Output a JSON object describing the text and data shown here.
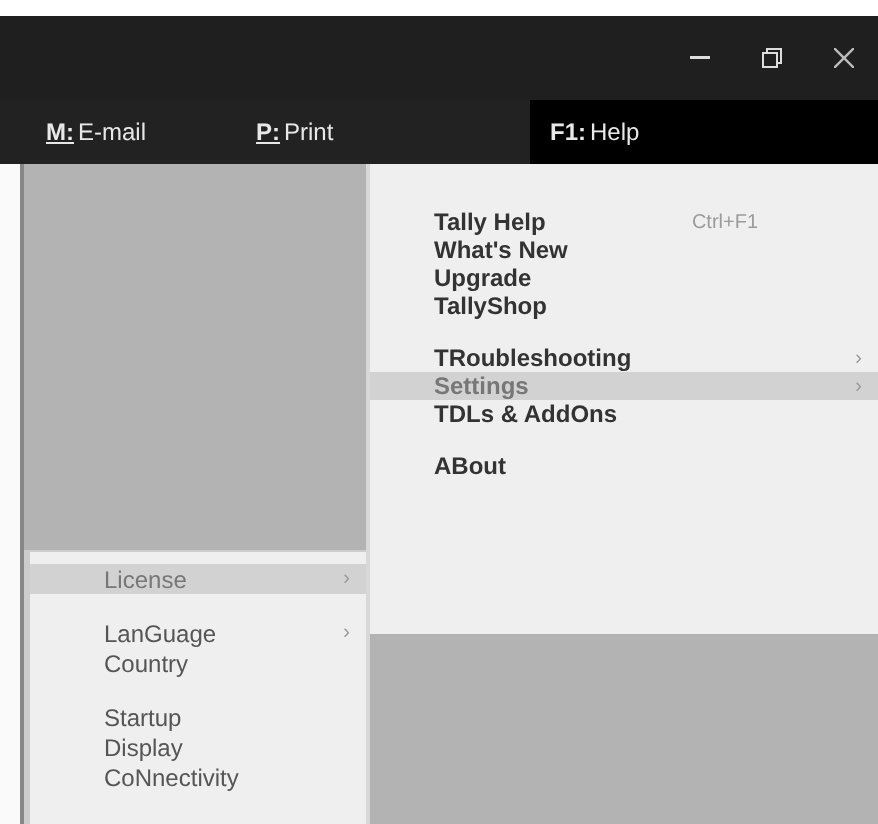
{
  "window": {
    "controls": [
      {
        "kind": "minimize"
      },
      {
        "kind": "restore"
      },
      {
        "kind": "close"
      }
    ]
  },
  "menu_bar": [
    {
      "key": "M:",
      "label": "E-mail",
      "underlined": true,
      "selected": false
    },
    {
      "key": "P:",
      "label": "Print",
      "underlined": true,
      "selected": false
    },
    {
      "key": "F1:",
      "label": "Help",
      "underlined": false,
      "selected": true
    }
  ],
  "help_menu": {
    "groups": [
      [
        {
          "label": "Tally Help",
          "shortcut": "Ctrl+F1",
          "selected": false
        },
        {
          "label": "What's **N**ew",
          "selected": false
        },
        {
          "label": "Upgrade",
          "selected": false
        },
        {
          "label": "TallyShop",
          "selected": false
        }
      ],
      [
        {
          "label": "TRoubleshooting",
          "arrow": "›",
          "selected": false
        },
        {
          "label": "Settings",
          "arrow": "›",
          "selected": true
        },
        {
          "label": "TDLs & AddOns",
          "selected": false
        }
      ],
      [
        {
          "label": "ABout",
          "selected": false
        }
      ]
    ]
  },
  "settings_menu": {
    "groups": [
      [
        {
          "label": "License",
          "arrow": "›",
          "selected": true
        }
      ],
      [
        {
          "label": "LanGuage",
          "arrow": "›",
          "selected": false
        },
        {
          "label": "Country",
          "selected": false
        }
      ],
      [
        {
          "label": "Startup",
          "selected": false
        },
        {
          "label": "Display",
          "selected": false
        },
        {
          "label": "CoNnectivity",
          "selected": false
        }
      ]
    ]
  }
}
